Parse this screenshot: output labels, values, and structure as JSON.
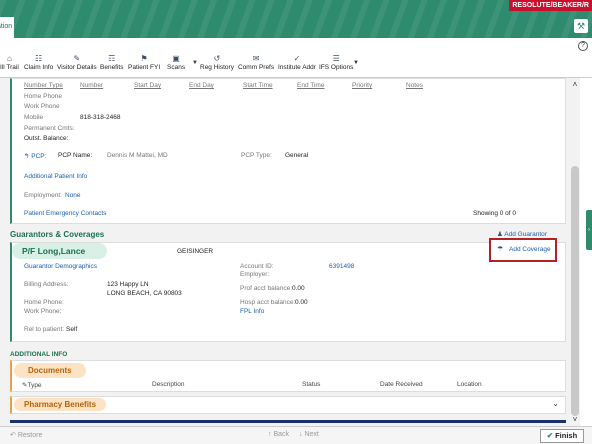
{
  "banner": {
    "env_label": "RESOLUTE/BEAKER/R",
    "active_tab": "ation"
  },
  "toolbar": {
    "items": [
      {
        "label": "Ill Trail"
      },
      {
        "label": "Claim Info"
      },
      {
        "label": "Visitor Details"
      },
      {
        "label": "Benefits"
      },
      {
        "label": "Patient FYI"
      },
      {
        "label": "Scans"
      },
      {
        "label": "Reg History"
      },
      {
        "label": "Comm Prefs"
      },
      {
        "label": "Institute Addr"
      },
      {
        "label": "IFS Options"
      }
    ],
    "help": "?"
  },
  "phone_table": {
    "headers": [
      "Number Type",
      "Number",
      "Start Day",
      "End Day",
      "Start Time",
      "End Time",
      "Priority",
      "Notes"
    ],
    "rows": [
      "Home Phone",
      "Work Phone",
      "Mobile"
    ],
    "mobile_number": "818-318-2468"
  },
  "patient": {
    "permanent_cmts_label": "Permanent Cmts:",
    "outst_balance_label": "Outst. Balance:",
    "pcp_link": "PCP:",
    "pcp_name_label": "PCP Name:",
    "pcp_name": "Dennis M Mattei, MD",
    "pcp_type_label": "PCP Type:",
    "pcp_type": "General",
    "additional_info_link": "Additional Patient Info",
    "employment_label": "Employment:",
    "employment_value": "None",
    "emergency_contacts_link": "Patient Emergency Contacts",
    "showing": "Showing 0 of 0"
  },
  "guarantors": {
    "section_title": "Guarantors & Coverages",
    "add_guarantor": "Add Guarantor",
    "name": "P/F Long,Lance",
    "payer": "GEISINGER",
    "demographics_link": "Guarantor Demographics",
    "account_id_label": "Account ID:",
    "account_id": "6391498",
    "employer_label": "Employer:",
    "billing_address_label": "Billing Address:",
    "billing_line1": "123 Happy LN",
    "billing_line2": "LONG BEACH, CA 90803",
    "prof_balance_label": "Prof acct balance:",
    "prof_balance": "0.00",
    "hosp_balance_label": "Hosp acct balance:",
    "hosp_balance": "0.00",
    "home_phone_label": "Home Phone:",
    "work_phone_label": "Work Phone:",
    "fpl_info_link": "FPL Info",
    "rel_label": "Rel to patient:",
    "rel_value": "Self",
    "add_coverage": "Add Coverage"
  },
  "additional_info": {
    "title": "ADDITIONAL INFO",
    "documents_title": "Documents",
    "doc_headers": [
      "Type",
      "Description",
      "Status",
      "Date Received",
      "Location"
    ],
    "pharmacy_title": "Pharmacy Benefits"
  },
  "footer": {
    "restore": "Restore",
    "back": "Back",
    "next": "Next",
    "finish": "Finish"
  }
}
